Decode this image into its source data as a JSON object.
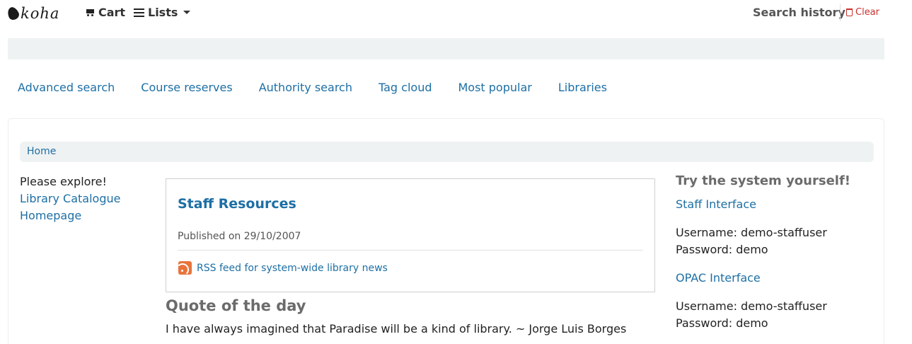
{
  "header": {
    "logo_text": "koha",
    "cart_label": "Cart",
    "lists_label": "Lists",
    "search_history_label": "Search history",
    "clear_label": "Clear"
  },
  "nav": {
    "links": [
      "Advanced search",
      "Course reserves",
      "Authority search",
      "Tag cloud",
      "Most popular",
      "Libraries"
    ]
  },
  "breadcrumb": {
    "home": "Home"
  },
  "left": {
    "intro": "Please explore!",
    "link": "Library Catalogue Homepage"
  },
  "news": {
    "title": "Staff Resources",
    "published": "Published on 29/10/2007",
    "rss_label": "RSS feed for system-wide library news"
  },
  "quote": {
    "title": "Quote of the day",
    "text": "I have always imagined that Paradise will be a kind of library. ~ Jorge Luis Borges"
  },
  "right": {
    "heading": "Try the system yourself!",
    "staff_link": "Staff Interface",
    "staff_username": "Username: demo-staffuser",
    "staff_password": "Password: demo",
    "opac_link": "OPAC Interface",
    "opac_username": "Username: demo-staffuser",
    "opac_password": "Password: demo"
  },
  "colors": {
    "link": "#1d6fa5",
    "clear": "#c9302c",
    "rss": "#e8743b",
    "panel_bg": "#eff2f2"
  }
}
